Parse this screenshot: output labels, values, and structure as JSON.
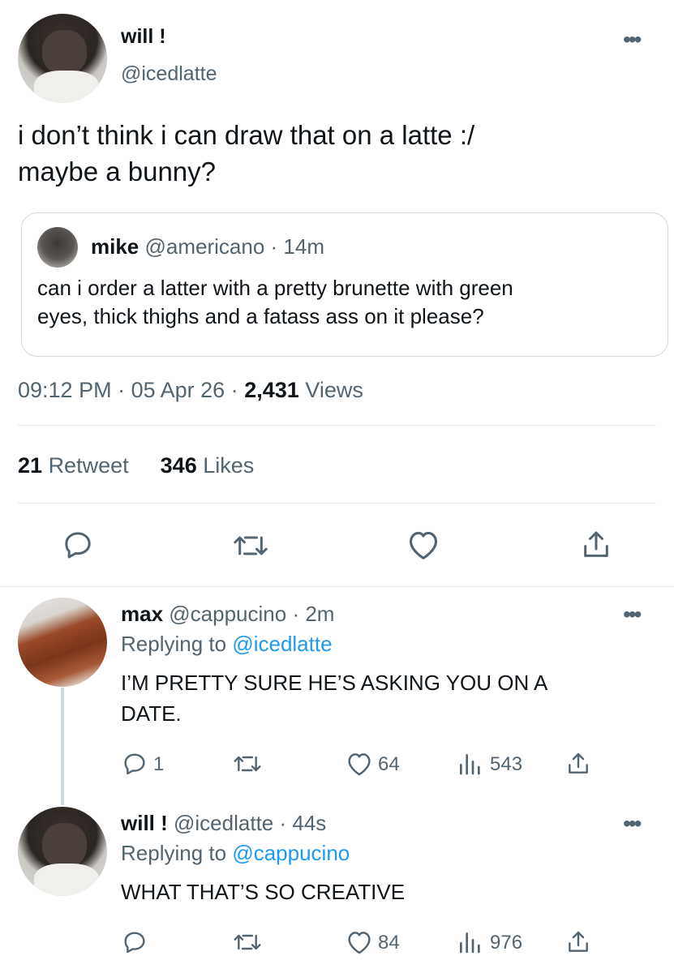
{
  "main_tweet": {
    "name": "will !",
    "handle": "@icedlatte",
    "text_line1": "i don’t think i can draw that on a latte :/",
    "text_line2": "maybe a bunny?",
    "quoted": {
      "name": "mike",
      "handle": "@americano",
      "time": "· 14m",
      "text_line1": "can i order a latter with a pretty brunette with green",
      "text_line2": "eyes, thick thighs and a fatass ass on it please?"
    },
    "time": "09:12 PM",
    "date": "· 05 Apr 26 ·",
    "views_count": "2,431",
    "views_label": "Views",
    "retweets_count": "21",
    "retweets_label": "Retweet",
    "likes_count": "346",
    "likes_label": "Likes"
  },
  "replies": [
    {
      "name": "max",
      "handle": "@cappucino",
      "time": "· 2m",
      "replying_label": "Replying to",
      "replying_to": "@icedlatte",
      "text_line1": "I’M PRETTY SURE HE’S ASKING YOU ON A",
      "text_line2": "DATE.",
      "reply_count": "1",
      "like_count": "64",
      "views_count": "543"
    },
    {
      "name": "will !",
      "handle": "@icedlatte",
      "time": "· 44s",
      "replying_label": "Replying to",
      "replying_to": "@cappucino",
      "text_line1": "WHAT THAT’S SO CREATIVE",
      "like_count": "84",
      "views_count": "976"
    }
  ],
  "icons": [
    "more-icon",
    "reply-icon",
    "retweet-icon",
    "like-icon",
    "share-icon",
    "views-icon"
  ],
  "colors": {
    "link": "#1d9bf0",
    "secondary": "#536471",
    "text": "#0f1419",
    "divider": "#e6e9ec"
  }
}
